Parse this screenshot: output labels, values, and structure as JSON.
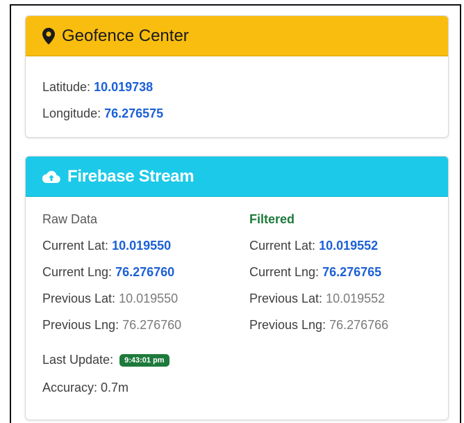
{
  "geofence": {
    "title": "Geofence Center",
    "latitude_label": "Latitude:",
    "latitude_value": "10.019738",
    "longitude_label": "Longitude:",
    "longitude_value": "76.276575"
  },
  "firebase": {
    "title": "Firebase Stream",
    "raw": {
      "heading": "Raw Data",
      "current_lat_label": "Current Lat:",
      "current_lat": "10.019550",
      "current_lng_label": "Current Lng:",
      "current_lng": "76.276760",
      "previous_lat_label": "Previous Lat:",
      "previous_lat": "10.019550",
      "previous_lng_label": "Previous Lng:",
      "previous_lng": "76.276760"
    },
    "filtered": {
      "heading": "Filtered",
      "current_lat_label": "Current Lat:",
      "current_lat": "10.019552",
      "current_lng_label": "Current Lng:",
      "current_lng": "76.276765",
      "previous_lat_label": "Previous Lat:",
      "previous_lat": "10.019552",
      "previous_lng_label": "Previous Lng:",
      "previous_lng": "76.276766"
    },
    "last_update_label": "Last Update:",
    "last_update_value": "9:43:01 pm",
    "accuracy_text": "Accuracy: 0.7m"
  },
  "icons": {
    "geofence": "map-marker-icon",
    "firebase": "cloud-upload-icon"
  },
  "colors": {
    "geofence_header": "#f9bd10",
    "firebase_header": "#1cc9e8",
    "value_blue": "#1b5fd6",
    "filtered_green": "#1e7a3c",
    "badge_green": "#1e7a3c"
  }
}
